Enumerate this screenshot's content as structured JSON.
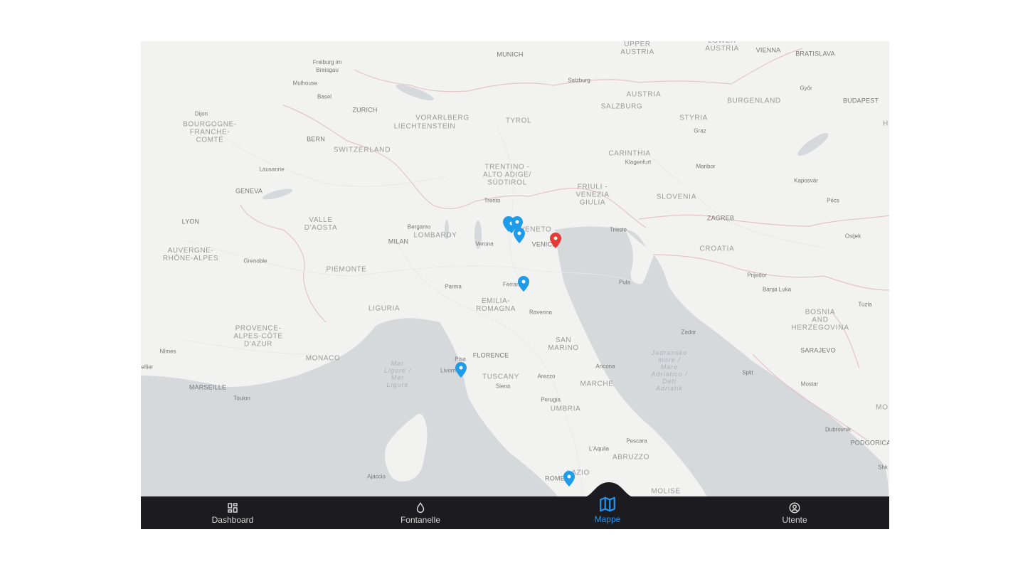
{
  "map": {
    "labels": {
      "upper_austria": "UPPER\nAUSTRIA",
      "lower_austria": "LOWER\nAUSTRIA",
      "vienna": "VIENNA",
      "bratislava": "BRATISLAVA",
      "munich": "MUNICH",
      "freiburg": "Freiburg im\nBreisgau",
      "mulhouse": "Mulhouse",
      "basel": "Basel",
      "zurich": "ZURICH",
      "salzburg_city": "Salzburg",
      "austria": "AUSTRIA",
      "gyor": "Győr",
      "burgenland": "BURGENLAND",
      "budapest": "BUDAPEST",
      "dijon": "Dijon",
      "bourgogne": "BOURGOGNE-\nFRANCHE-\nCOMTÉ",
      "vorarlberg": "VORARLBERG",
      "liechtenstein": "LIECHTENSTEIN",
      "tyrol": "TYROL",
      "salzburg": "SALZBURG",
      "styria": "STYRIA",
      "graz": "Graz",
      "bern": "BERN",
      "switzerland": "SWITZERLAND",
      "trentino": "TRENTINO -\nALTO ADIGE/\nSÜDTIROL",
      "carinthia": "CARINTHIA",
      "klagenfurt": "Klagenfurt",
      "maribor": "Maribor",
      "lausanne": "Lausanne",
      "geneva": "GENEVA",
      "friuli": "FRIULI -\nVENEZIA\nGIULIA",
      "slovenia": "SLOVENIA",
      "kaposvar": "Kaposvár",
      "pecs": "Pécs",
      "trento": "Trento",
      "lyon": "LYON",
      "valle_daosta": "VALLE\nD'AOSTA",
      "bergamo": "Bergamo",
      "lombardy": "LOMBARDY",
      "veneto": "VENETO",
      "trieste": "Trieste",
      "zagreb": "ZAGREB",
      "osijek": "Osijek",
      "auvergne": "AUVERGNE-\nRHÔNE-ALPES",
      "milan": "MILAN",
      "verona": "Verona",
      "venice": "VENICE",
      "croatia": "CROATIA",
      "grenoble": "Grenoble",
      "piemonte": "PIEMONTE",
      "prijedor": "Prijedor",
      "parma": "Parma",
      "ferrara": "Ferrara",
      "pula": "Pula",
      "banja_luka": "Banja Luka",
      "emilia": "EMILIA-\nROMAGNA",
      "liguria": "LIGURIA",
      "ravenna": "Ravenna",
      "tuzla": "Tuzla",
      "bosnia": "BOSNIA\nAND\nHERZEGOVINA",
      "provence": "PROVENCE-\nALPES-CÔTE\nD'AZUR",
      "san_marino": "SAN\nMARINO",
      "zadar": "Zadar",
      "adriatic": "Jadransko\nmore /\nMare\nAdriatico /\nDeti\nAdriatik",
      "sarajevo": "SARAJEVO",
      "nimes": "Nîmes",
      "monaco": "MONACO",
      "florence": "FLORENCE",
      "pisa": "Pisa",
      "ancona": "Ancona",
      "ligurian_sea": "Mar\nLigure /\nMer\nLigure",
      "montpellier": "ellier",
      "livorno": "Livorn",
      "split": "Split",
      "tuscany": "TUSCANY",
      "arezzo": "Arezzo",
      "marche": "MARCHE",
      "siena": "Siena",
      "mostar": "Mostar",
      "marseille": "MARSEILLE",
      "perugia": "Perugia",
      "toulon": "Toulon",
      "umbria": "UMBRIA",
      "montenegro_cut": "MO",
      "dubrovnik": "Dubrovnik",
      "pescara": "Pescara",
      "podgorica": "PODGORICA",
      "laquila": "L'Aquila",
      "abruzzo": "ABRUZZO",
      "hungary_cut": "H",
      "lazio": "LAZIO",
      "ajaccio": "Ajaccio",
      "rome": "ROME",
      "shk": "Shk",
      "molise": "MOLISE"
    },
    "markers": [
      {
        "name": "marker-1",
        "color": "#1e9be9"
      },
      {
        "name": "marker-2",
        "color": "#1e9be9"
      },
      {
        "name": "marker-3",
        "color": "#1e9be9"
      },
      {
        "name": "marker-4",
        "color": "#1e9be9"
      },
      {
        "name": "marker-5",
        "color": "#1e9be9"
      },
      {
        "name": "marker-6",
        "color": "#1e9be9"
      },
      {
        "name": "marker-7",
        "color": "#1e9be9"
      },
      {
        "name": "marker-selected",
        "color": "#e53935"
      }
    ]
  },
  "nav": {
    "items": [
      {
        "label": "Dashboard",
        "icon": "dashboard-icon",
        "active": false
      },
      {
        "label": "Fontanelle",
        "icon": "water-drop-icon",
        "active": false
      },
      {
        "label": "Mappe",
        "icon": "map-icon",
        "active": true
      },
      {
        "label": "Utente",
        "icon": "account-circle-icon",
        "active": false
      }
    ],
    "colors": {
      "background": "#1c1b1f",
      "active": "#2196f3",
      "inactive": "#d6d6d6"
    }
  }
}
